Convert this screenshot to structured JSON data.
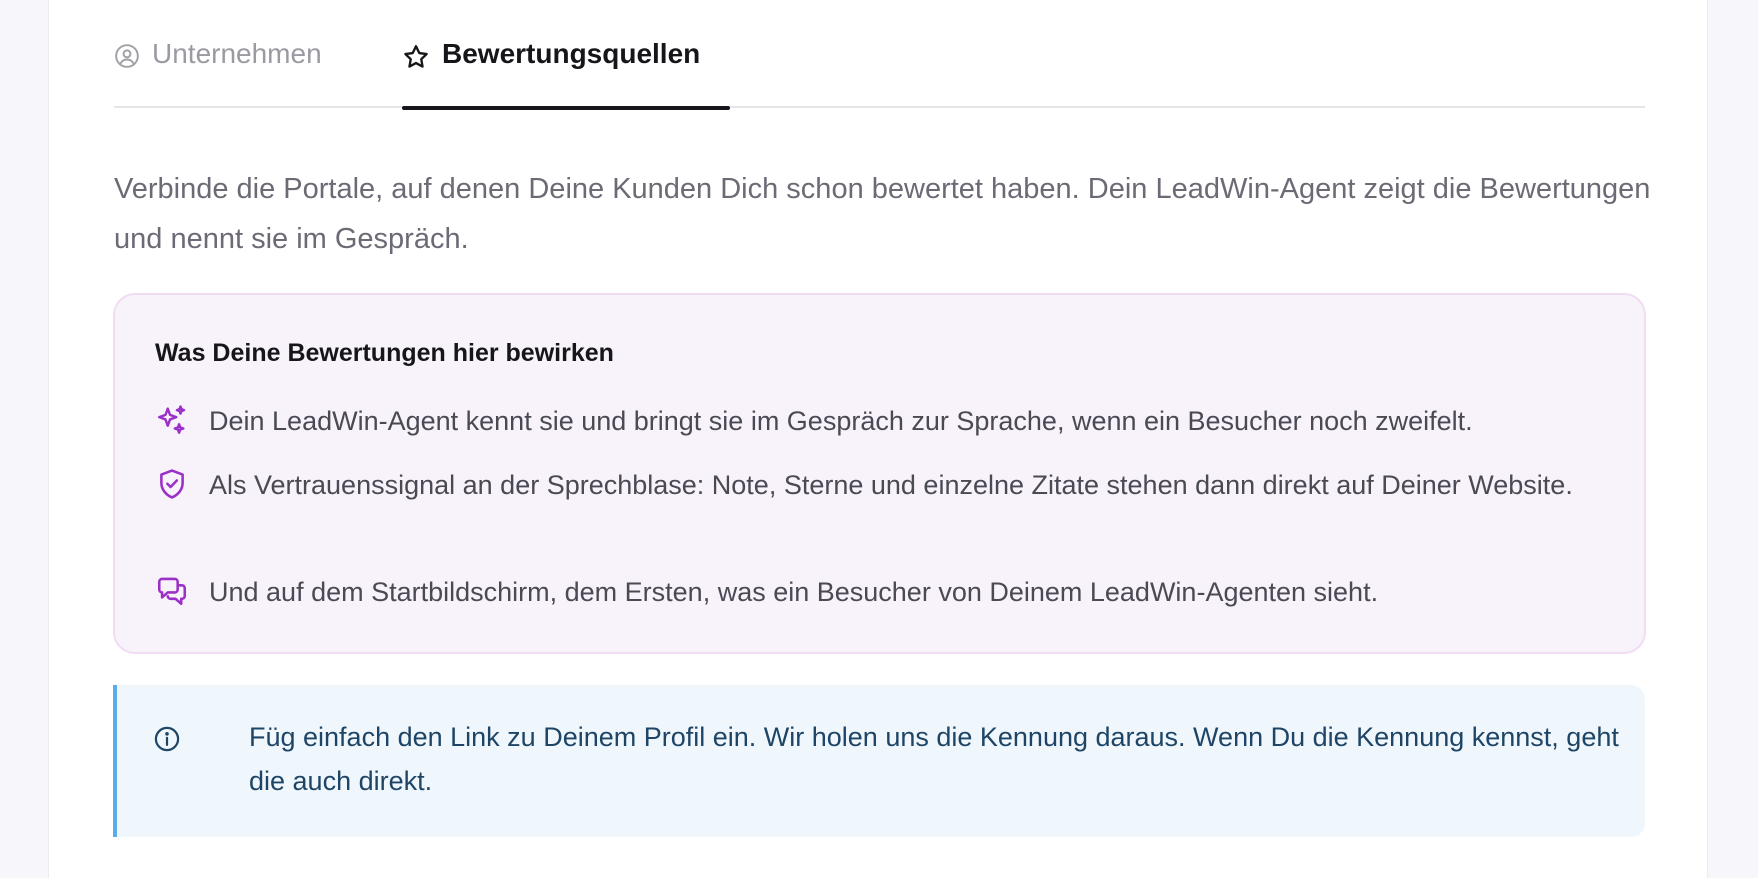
{
  "tabs": [
    {
      "label": "Unternehmen",
      "icon": "user-circle-icon",
      "active": false
    },
    {
      "label": "Bewertungsquellen",
      "icon": "star-icon",
      "active": true
    }
  ],
  "intro": "Verbinde die Portale, auf denen Deine Kunden Dich schon bewertet haben. Dein LeadWin-Agent zeigt die Bewertungen und nennt sie im Gespräch.",
  "benefits": {
    "title": "Was Deine Bewertungen hier bewirken",
    "items": [
      {
        "icon": "sparkles-icon",
        "text": "Dein LeadWin-Agent kennt sie und bringt sie im Gespräch zur Sprache, wenn ein Besucher noch zweifelt."
      },
      {
        "icon": "shield-check-icon",
        "text": "Als Vertrauenssignal an der Sprechblase: Note, Sterne und einzelne Zitate stehen dann direkt auf Deiner Website."
      },
      {
        "icon": "chat-bubbles-icon",
        "text": "Und auf dem Startbildschirm, dem Ersten, was ein Besucher von Deinem LeadWin-Agenten sieht."
      }
    ]
  },
  "info": {
    "icon": "info-circle-icon",
    "text": "Füg einfach den Link zu Deinem Profil ein. Wir holen uns die Kennung daraus. Wenn Du die Kennung kennst, geht die auch direkt."
  },
  "colors": {
    "accent_purple": "#9b30c8",
    "info_blue": "#5aace8",
    "info_text": "#1e4566",
    "benefits_bg": "#f8f2fa"
  }
}
